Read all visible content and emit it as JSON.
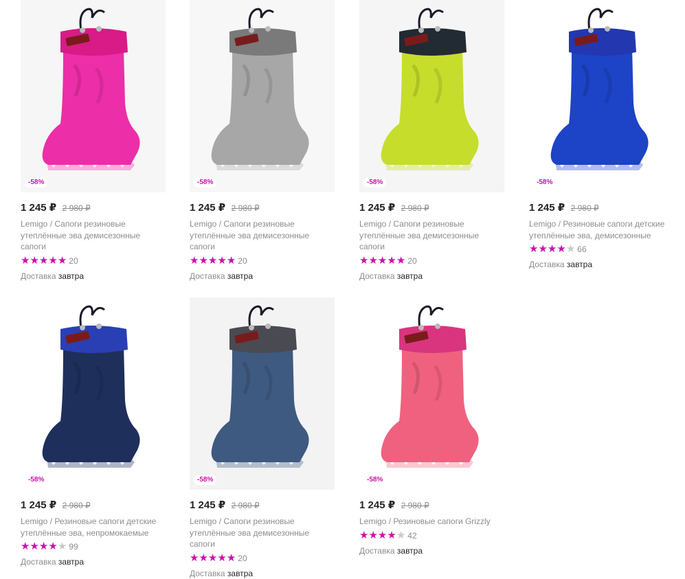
{
  "products": [
    {
      "discount": "-58%",
      "price": "1 245 ₽",
      "old_price": "2 980 ₽",
      "title": "Lemigo / Сапоги резиновые утеплённые эва демисезонные сапоги",
      "rating": 5,
      "reviews": "20",
      "delivery_label": "Доставка",
      "delivery_value": "завтра",
      "boot_color": "#ec2ea8",
      "cuff_color": "#d81b86",
      "bg_color": "#f6f6f6"
    },
    {
      "discount": "-58%",
      "price": "1 245 ₽",
      "old_price": "2 980 ₽",
      "title": "Lemigo / Сапоги резиновые утеплённые эва демисезонные сапоги",
      "rating": 5,
      "reviews": "20",
      "delivery_label": "Доставка",
      "delivery_value": "завтра",
      "boot_color": "#a7a7a7",
      "cuff_color": "#7a7a7a",
      "bg_color": "#f7f7f7"
    },
    {
      "discount": "-58%",
      "price": "1 245 ₽",
      "old_price": "2 980 ₽",
      "title": "Lemigo / Сапоги резиновые утеплённые эва демисезонные сапоги",
      "rating": 5,
      "reviews": "20",
      "delivery_label": "Доставка",
      "delivery_value": "завтра",
      "boot_color": "#c6dd2c",
      "cuff_color": "#222a33",
      "bg_color": "#f5f5f5"
    },
    {
      "discount": "-58%",
      "price": "1 245 ₽",
      "old_price": "2 980 ₽",
      "title": "Lemigo / Резиновые сапоги детские утеплённые эва, демисезонные",
      "rating": 4,
      "reviews": "66",
      "delivery_label": "Доставка",
      "delivery_value": "завтра",
      "boot_color": "#1d43c6",
      "cuff_color": "#2337b0",
      "bg_color": "#ffffff"
    },
    {
      "discount": "-58%",
      "price": "1 245 ₽",
      "old_price": "2 980 ₽",
      "title": "Lemigo / Резиновые сапоги детские утеплённые эва, непромокаемые",
      "rating": 4,
      "reviews": "99",
      "delivery_label": "Доставка",
      "delivery_value": "завтра",
      "boot_color": "#1e2f5c",
      "cuff_color": "#2a3fb4",
      "bg_color": "#ffffff"
    },
    {
      "discount": "-58%",
      "price": "1 245 ₽",
      "old_price": "2 980 ₽",
      "title": "Lemigo / Сапоги резиновые утеплённые эва демисезонные сапоги",
      "rating": 5,
      "reviews": "20",
      "delivery_label": "Доставка",
      "delivery_value": "завтра",
      "boot_color": "#3f5a80",
      "cuff_color": "#4a4a52",
      "bg_color": "#f3f3f3"
    },
    {
      "discount": "-58%",
      "price": "1 245 ₽",
      "old_price": "2 980 ₽",
      "title": "Lemigo / Резиновые сапоги Grizzly",
      "rating": 4,
      "reviews": "42",
      "delivery_label": "Доставка",
      "delivery_value": "завтра",
      "boot_color": "#f0617f",
      "cuff_color": "#d9357f",
      "bg_color": "#ffffff"
    }
  ],
  "icons": {
    "star": "star-icon",
    "boot": "boot-image"
  },
  "colors": {
    "accent": "#cb11ab",
    "muted": "#8c8c8c",
    "text": "#242424"
  }
}
